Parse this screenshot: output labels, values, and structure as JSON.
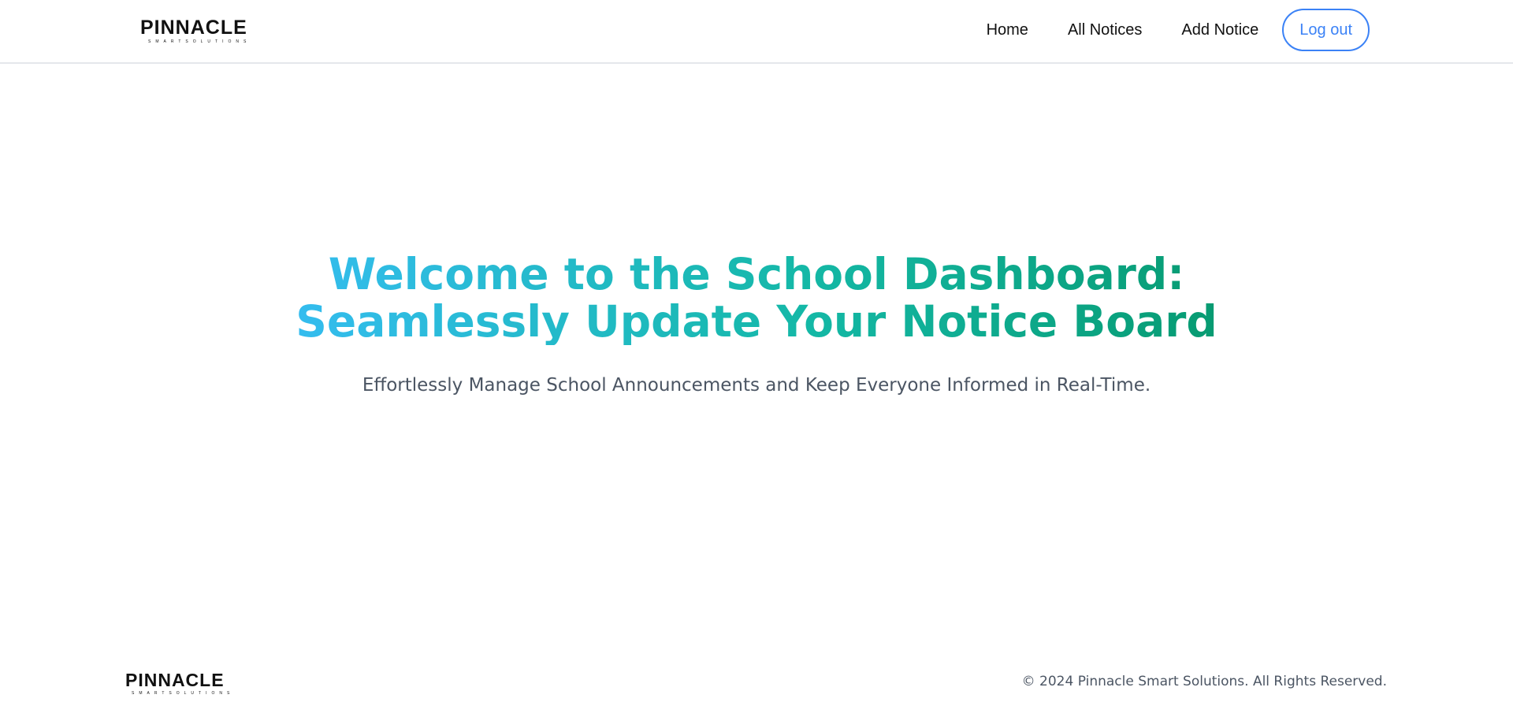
{
  "header": {
    "logo": {
      "word": "PINNACLE",
      "tag_left": "SMART",
      "tag_right": "SOLUTIONS"
    },
    "nav": {
      "home": "Home",
      "all_notices": "All Notices",
      "add_notice": "Add Notice",
      "logout": "Log out"
    }
  },
  "hero": {
    "title": "Welcome to the School Dashboard: Seamlessly Update Your Notice Board",
    "subtitle": "Effortlessly Manage School Announcements and Keep Everyone Informed in Real-Time."
  },
  "footer": {
    "logo": {
      "word": "PINNACLE",
      "tag_left": "SMART",
      "tag_right": "SOLUTIONS"
    },
    "copyright": "© 2024 Pinnacle Smart Solutions. All Rights Reserved."
  },
  "colors": {
    "accent_blue": "#3b82f6",
    "gradient_start": "#38bdf8",
    "gradient_mid": "#14b8a6",
    "gradient_end": "#059669",
    "text_muted": "#4b5563"
  }
}
